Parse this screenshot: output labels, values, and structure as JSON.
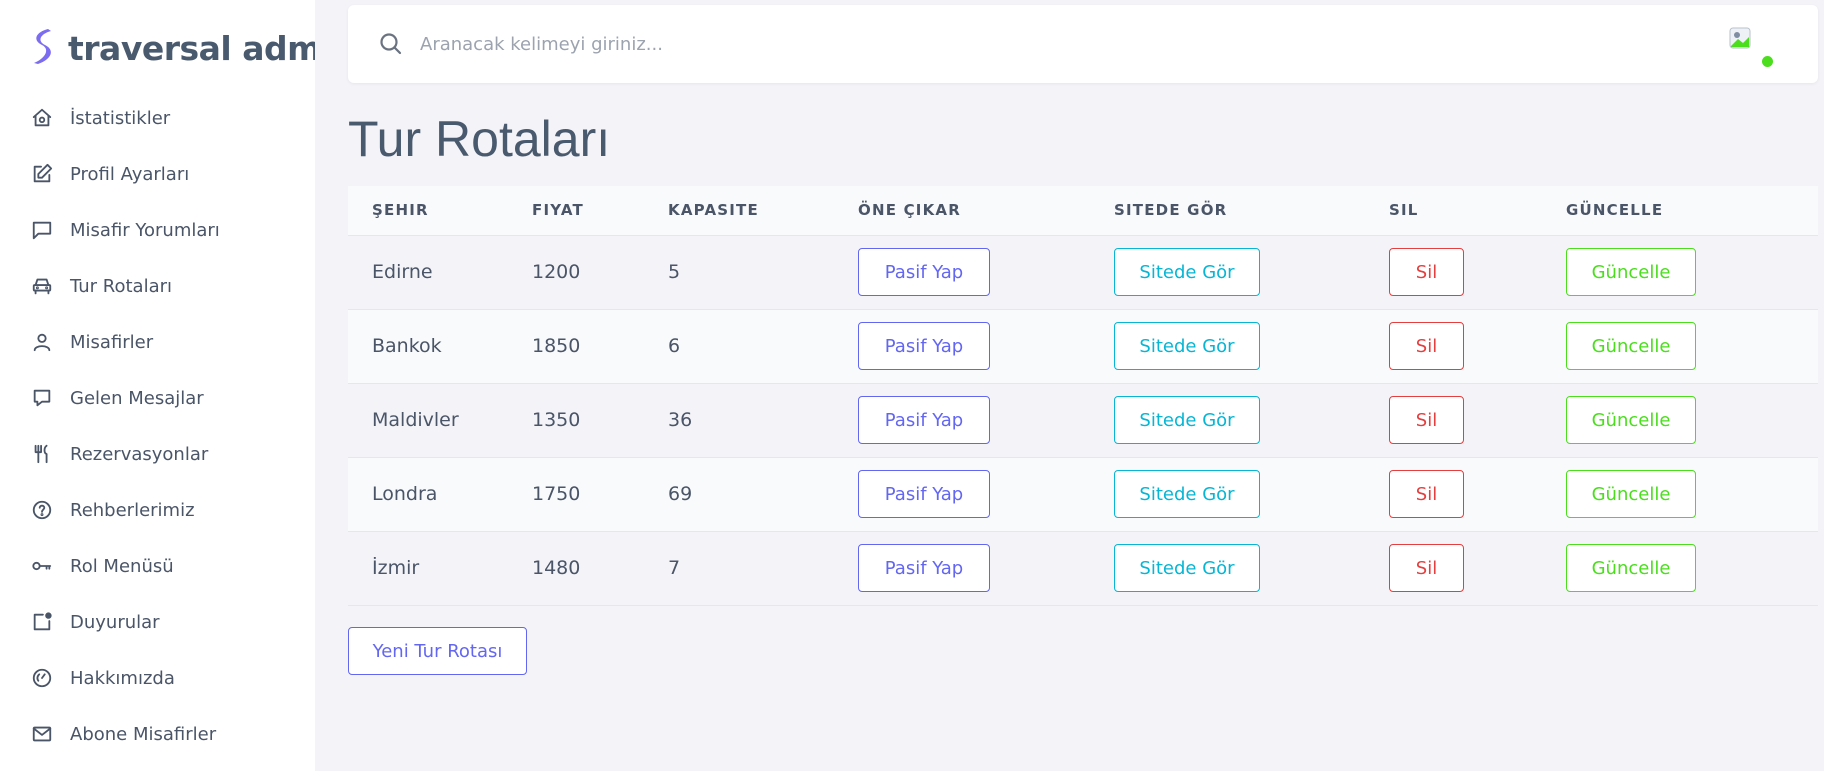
{
  "brand": {
    "name": "traversal admin",
    "logo_color": "#7c6cf0"
  },
  "sidebar": {
    "items": [
      {
        "label": "İstatistikler",
        "icon": "home-icon"
      },
      {
        "label": "Profil Ayarları",
        "icon": "edit-icon"
      },
      {
        "label": "Misafir Yorumları",
        "icon": "message-square-icon"
      },
      {
        "label": "Tur Rotaları",
        "icon": "car-icon"
      },
      {
        "label": "Misafirler",
        "icon": "user-icon"
      },
      {
        "label": "Gelen Mesajlar",
        "icon": "chat-icon"
      },
      {
        "label": "Rezervasyonlar",
        "icon": "utensils-icon"
      },
      {
        "label": "Rehberlerimiz",
        "icon": "help-circle-icon"
      },
      {
        "label": "Rol Menüsü",
        "icon": "key-icon"
      },
      {
        "label": "Duyurular",
        "icon": "notification-icon"
      },
      {
        "label": "Hakkımızda",
        "icon": "dashboard-gauge-icon"
      },
      {
        "label": "Abone Misafirler",
        "icon": "mail-icon"
      }
    ]
  },
  "header": {
    "search_placeholder": "Aranacak kelimeyi giriniz...",
    "status_color": "#4ade1d"
  },
  "page": {
    "title": "Tur Rotaları"
  },
  "table": {
    "columns": [
      "ŞEHIR",
      "FIYAT",
      "KAPASITE",
      "ÖNE ÇIKAR",
      "SITEDE GÖR",
      "SIL",
      "GÜNCELLE"
    ],
    "rows": [
      {
        "city": "Edirne",
        "price": "1200",
        "capacity": "5"
      },
      {
        "city": "Bankok",
        "price": "1850",
        "capacity": "6"
      },
      {
        "city": "Maldivler",
        "price": "1350",
        "capacity": "36"
      },
      {
        "city": "Londra",
        "price": "1750",
        "capacity": "69"
      },
      {
        "city": "İzmir",
        "price": "1480",
        "capacity": "7"
      }
    ],
    "actions": {
      "feature": "Pasif Yap",
      "view": "Sitede Gör",
      "delete": "Sil",
      "update": "Güncelle"
    }
  },
  "new_button": "Yeni Tur Rotası",
  "colors": {
    "primary": "#6366f1",
    "info": "#06b6d4",
    "danger": "#e53e3e",
    "success": "#4ade1d"
  }
}
